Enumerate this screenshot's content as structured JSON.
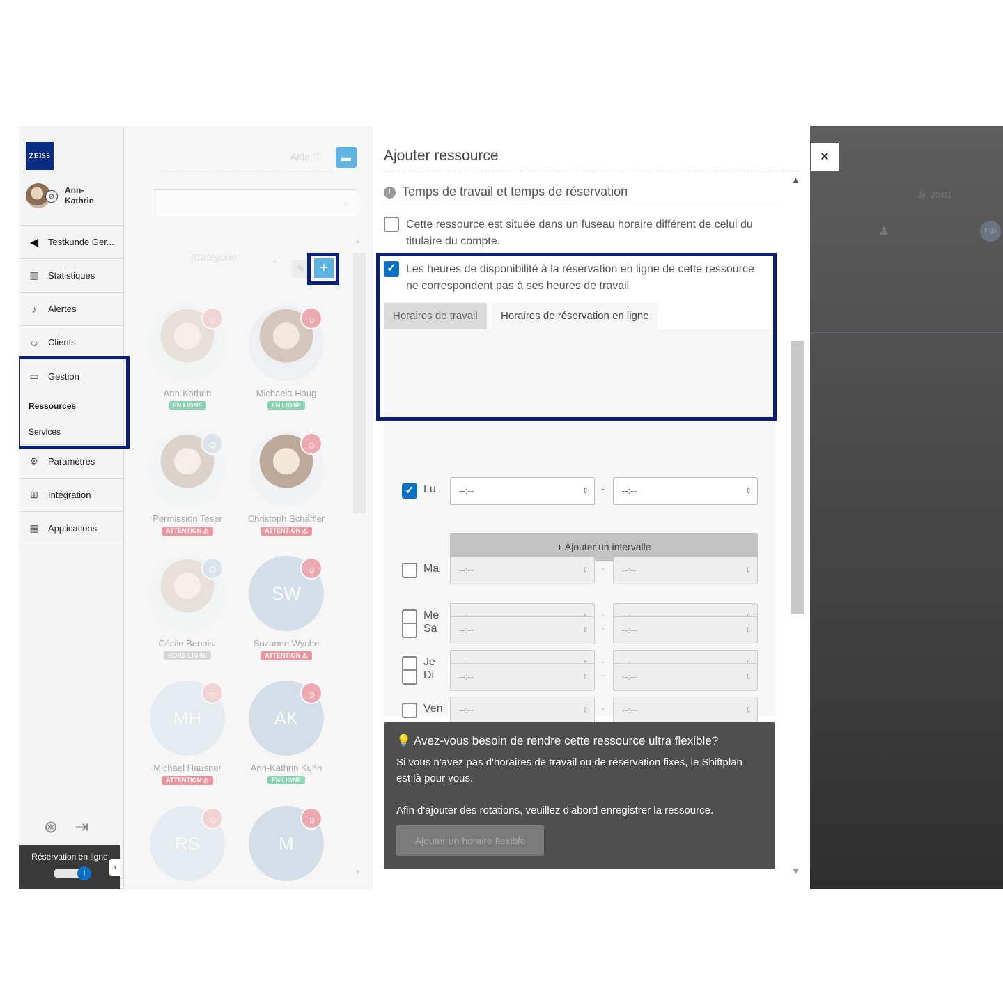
{
  "sidebar": {
    "logo": "ZEISS",
    "user_name": "Ann-\nKathrin",
    "items": [
      {
        "label": "Testkunde Ger...",
        "icon": "back-circle-icon"
      },
      {
        "label": "Statistiques",
        "icon": "bar-chart-icon"
      },
      {
        "label": "Alertes",
        "icon": "bell-icon"
      },
      {
        "label": "Clients",
        "icon": "user-icon"
      },
      {
        "label": "Gestion",
        "icon": "briefcase-icon"
      },
      {
        "label": "Ressources"
      },
      {
        "label": "Services"
      },
      {
        "label": "Paramètres",
        "icon": "gears-icon"
      },
      {
        "label": "Intégration",
        "icon": "integration-icon"
      },
      {
        "label": "Applications",
        "icon": "grid-icon"
      }
    ],
    "online_booking_label": "Réservation en ligne"
  },
  "list": {
    "help_label": "Aide",
    "category_label": "(Catégorie",
    "cards": [
      {
        "name": "Ann-Kathrin",
        "status": "EN LIGNE",
        "initials": ""
      },
      {
        "name": "Michaela Haug",
        "status": "EN LIGNE",
        "initials": ""
      },
      {
        "name": "Permission Teser",
        "status": "ATTENTION",
        "initials": ""
      },
      {
        "name": "Christoph Schäffler",
        "status": "ATTENTION",
        "initials": ""
      },
      {
        "name": "Cécile Benoist",
        "status": "HORS LIGNE",
        "initials": ""
      },
      {
        "name": "Suzanne Wyche",
        "status": "ATTENTION",
        "initials": "SW"
      },
      {
        "name": "Michael Hausner",
        "status": "ATTENTION",
        "initials": "MH"
      },
      {
        "name": "Ann-Kathrin Kuhn",
        "status": "EN LIGNE",
        "initials": "AK"
      },
      {
        "name": "",
        "status": "",
        "initials": "RS"
      },
      {
        "name": "",
        "status": "",
        "initials": "M"
      }
    ]
  },
  "modal": {
    "title": "Ajouter ressource",
    "section_title": "Temps de travail et temps de réservation",
    "timezone_checkbox": "Cette ressource est située dans un fuseau horaire différent de celui du titulaire du compte.",
    "online_hours_checkbox": "Les heures de disponibilité à la réservation en ligne de cette ressource ne correspondent pas à ses heures de travail",
    "tabs": [
      "Horaires de travail",
      "Horaires de réservation en ligne"
    ],
    "time_placeholder": "--:--",
    "add_interval": "+ Ajouter un intervalle",
    "days": [
      {
        "label": "Lu",
        "checked": true
      },
      {
        "label": "Ma",
        "checked": false
      },
      {
        "label": "Me",
        "checked": false
      },
      {
        "label": "Je",
        "checked": false
      },
      {
        "label": "Ven",
        "checked": false
      },
      {
        "label": "Sa",
        "checked": false
      },
      {
        "label": "Di",
        "checked": false
      }
    ],
    "flex": {
      "title": "Avez-vous besoin de rendre cette ressource ultra flexible?",
      "text1": "Si vous n'avez pas d'horaires de travail ou de réservation fixes, le Shiftplan est là pour vous.",
      "text2": "Afin d'ajouter des rotations, veuillez d'abord enregistrer la ressource.",
      "button": "Ajouter un horaire flexible"
    }
  },
  "background": {
    "date_label": "Je. 20/01",
    "avatar_text": "Rgs"
  },
  "colors": {
    "highlight": "#0a1f7a",
    "accent": "#0a72c6",
    "online": "#2fb87a",
    "attention": "#e0455a"
  }
}
